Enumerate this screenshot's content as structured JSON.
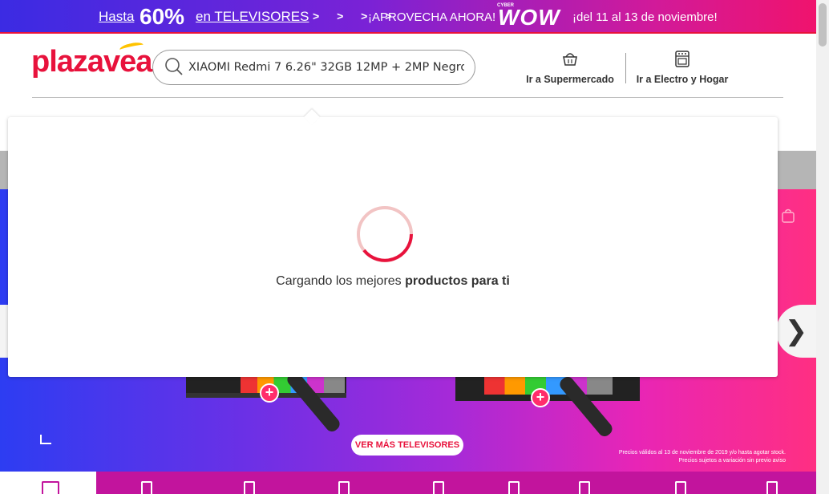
{
  "promo_bar": {
    "hasta": "Hasta",
    "percent": "60%",
    "category": "en TELEVISORES",
    "arrows": "> > > >",
    "cta": "¡APROVECHA AHORA!",
    "badge_small": "CYBER",
    "badge_big": "WOW",
    "dates": "¡del 11 al 13 de noviembre!"
  },
  "header": {
    "logo": "plazavea",
    "search": {
      "value": "XIAOMI Redmi 7 6.26\" 32GB 12MP + 2MP Negro"
    },
    "nav": [
      {
        "label": "Ir a Supermercado",
        "icon": "basket-icon"
      },
      {
        "label": "Ir a Electro y Hogar",
        "icon": "stove-icon"
      }
    ]
  },
  "loading": {
    "text_regular": "Cargando los mejores",
    "text_bold": "productos para ti"
  },
  "banner": {
    "cta": "VER MÁS TELEVISORES",
    "legal_line1": "Precios válidos al 13 de noviembre de 2019 y/o hasta agotar stock.",
    "legal_line2": "Precios sujetos a variación sin previo aviso"
  },
  "colors": {
    "brand_red": "#e8123c",
    "brand_yellow": "#ffc300",
    "category_bar": "#c2149d"
  }
}
